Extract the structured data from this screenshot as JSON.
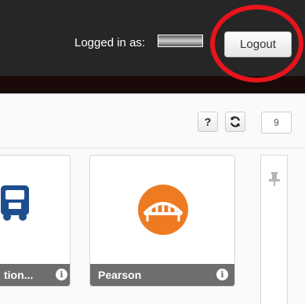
{
  "header": {
    "logged_in_label": "Logged in as:",
    "logout_label": "Logout"
  },
  "toolbar": {
    "help_label": "?",
    "refresh_icon": "refresh-icon",
    "count_value": "9"
  },
  "tiles": [
    {
      "name": "tion...",
      "icon": "bus-icon"
    },
    {
      "name": "Pearson",
      "icon": "pearson-bridge-logo",
      "logo_color": "#ee7b22"
    }
  ],
  "side_panel": {
    "icon": "pin-icon"
  },
  "colors": {
    "header_bg": "#262626",
    "highlight": "#e8141c",
    "tile_footer": "#6e6e6e",
    "pearson_orange": "#ee7b22",
    "bus_blue": "#1f4e8c"
  }
}
